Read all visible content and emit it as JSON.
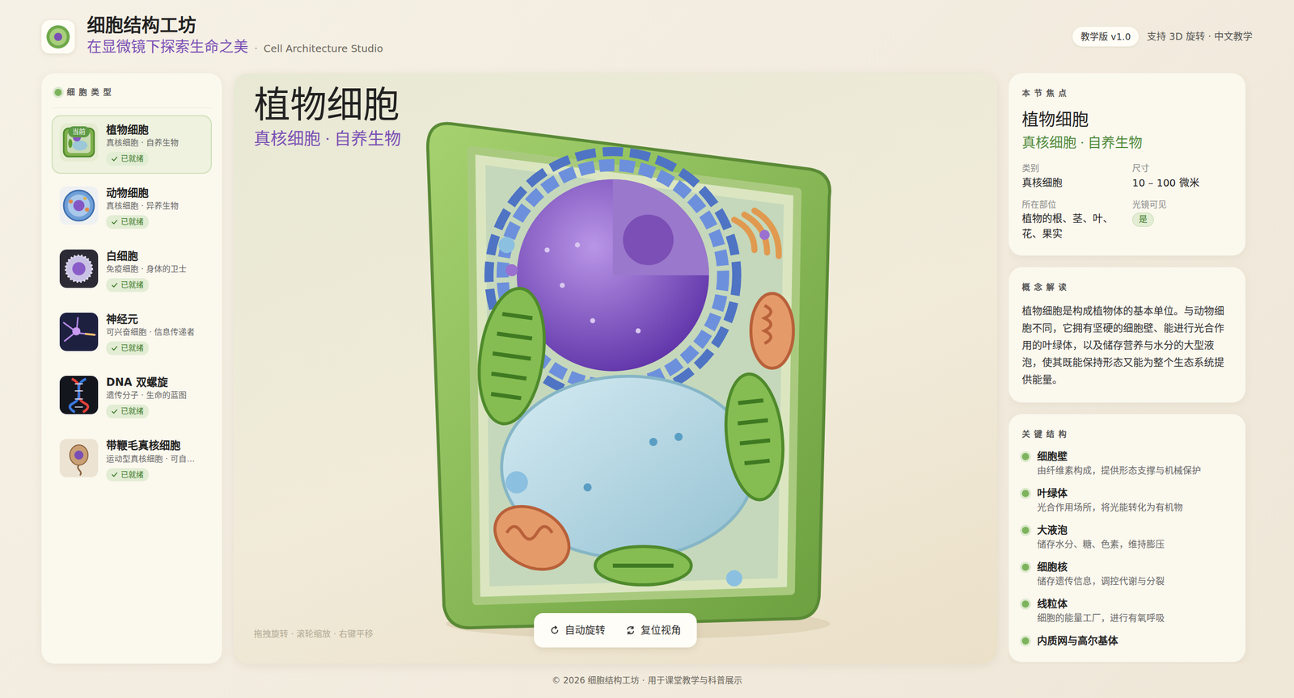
{
  "header": {
    "title": "细胞结构工坊",
    "subtitle": "在显微镜下探索生命之美",
    "separator": "·",
    "english": "Cell Architecture Studio",
    "badge": "教学版 v1.0",
    "meta": "支持 3D 旋转 · 中文教学"
  },
  "sidebar": {
    "title": "细胞类型",
    "current_badge": "当前",
    "items": [
      {
        "name": "植物细胞",
        "sub": "真核细胞 · 自养生物",
        "status": "已就绪",
        "selected": true,
        "kind": "plant"
      },
      {
        "name": "动物细胞",
        "sub": "真核细胞 · 异养生物",
        "status": "已就绪",
        "selected": false,
        "kind": "animal"
      },
      {
        "name": "白细胞",
        "sub": "免疫细胞 · 身体的卫士",
        "status": "已就绪",
        "selected": false,
        "kind": "leukocyte"
      },
      {
        "name": "神经元",
        "sub": "可兴奋细胞 · 信息传递者",
        "status": "已就绪",
        "selected": false,
        "kind": "neuron"
      },
      {
        "name": "DNA 双螺旋",
        "sub": "遗传分子 · 生命的蓝图",
        "status": "已就绪",
        "selected": false,
        "kind": "dna"
      },
      {
        "name": "带鞭毛真核细胞",
        "sub": "运动型真核细胞 · 可自…",
        "status": "已就绪",
        "selected": false,
        "kind": "flagellate"
      }
    ]
  },
  "stage": {
    "title": "植物细胞",
    "subtitle": "真核细胞 · 自养生物",
    "hint": "拖拽旋转 · 滚轮缩放 · 右键平移",
    "buttons": [
      {
        "label": "自动旋转",
        "kind": "rotate"
      },
      {
        "label": "复位视角",
        "kind": "reset"
      }
    ]
  },
  "focus": {
    "label": "本节焦点",
    "title": "植物细胞",
    "subtitle": "真核细胞 · 自养生物",
    "fields": [
      {
        "label": "类别",
        "value": "真核细胞",
        "kind": "text"
      },
      {
        "label": "尺寸",
        "value": "10 – 100 微米",
        "kind": "text"
      },
      {
        "label": "所在部位",
        "value": "植物的根、茎、叶、花、果实",
        "kind": "text"
      },
      {
        "label": "光镜可见",
        "value": "是",
        "kind": "pill"
      }
    ]
  },
  "concept": {
    "label": "概念解读",
    "text": "植物细胞是构成植物体的基本单位。与动物细胞不同，它拥有坚硬的细胞壁、能进行光合作用的叶绿体，以及储存营养与水分的大型液泡，使其既能保持形态又能为整个生态系统提供能量。"
  },
  "structures": {
    "label": "关键结构",
    "items": [
      {
        "name": "细胞壁",
        "desc": "由纤维素构成，提供形态支撑与机械保护"
      },
      {
        "name": "叶绿体",
        "desc": "光合作用场所，将光能转化为有机物"
      },
      {
        "name": "大液泡",
        "desc": "储存水分、糖、色素，维持膨压"
      },
      {
        "name": "细胞核",
        "desc": "储存遗传信息，调控代谢与分裂"
      },
      {
        "name": "线粒体",
        "desc": "细胞的能量工厂，进行有氧呼吸"
      },
      {
        "name": "内质网与高尔基体",
        "desc": ""
      }
    ]
  },
  "footer": "© 2026 细胞结构工坊 · 用于课堂教学与科普展示"
}
